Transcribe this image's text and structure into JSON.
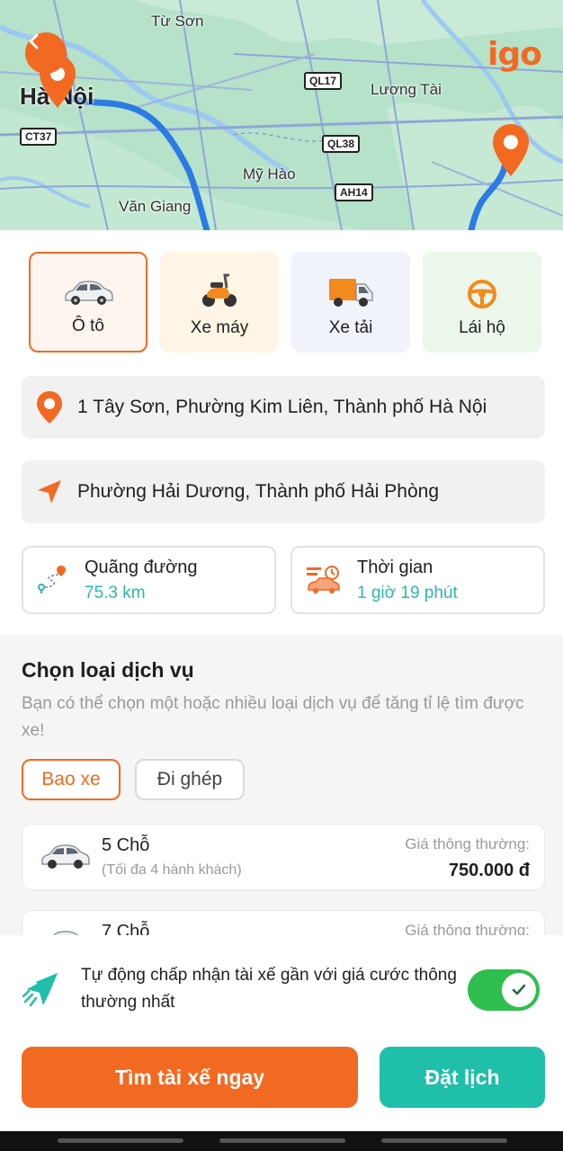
{
  "map": {
    "labels": {
      "tu_son": "Từ Sơn",
      "ha_noi": "Hà Nội",
      "luong_tai": "Lương Tài",
      "my_hao": "Mỹ Hào",
      "van_giang": "Văn Giang"
    },
    "road_badges": {
      "ql17": "QL17",
      "ct37": "CT37",
      "ql38": "QL38",
      "ah14": "AH14"
    },
    "logo": "igo"
  },
  "services": [
    {
      "label": "Ô tô",
      "icon": "car-icon",
      "selected": true
    },
    {
      "label": "Xe máy",
      "icon": "scooter-icon",
      "selected": false
    },
    {
      "label": "Xe tải",
      "icon": "truck-icon",
      "selected": false
    },
    {
      "label": "Lái hộ",
      "icon": "steering-wheel-icon",
      "selected": false
    }
  ],
  "route": {
    "pickup": "1 Tây Sơn, Phường Kim Liên, Thành phố Hà Nội",
    "destination": "Phường Hải Dương, Thành phố Hải Phòng"
  },
  "stats": {
    "distance_label": "Quãng đường",
    "distance_value": "75.3 km",
    "time_label": "Thời gian",
    "time_value": "1 giờ 19 phút"
  },
  "service_type": {
    "title": "Chọn loại dịch vụ",
    "description": "Bạn có thể chọn một hoặc nhiều loại dịch vụ để tăng tỉ lệ tìm được xe!",
    "options": [
      {
        "label": "Bao xe",
        "active": true
      },
      {
        "label": "Đi ghép",
        "active": false
      }
    ],
    "vehicles": [
      {
        "name": "5 Chỗ",
        "capacity": "(Tối đa 4 hành khách)",
        "price_label": "Giá thông thường:",
        "price": "750.000 đ"
      },
      {
        "name": "7 Chỗ",
        "capacity": "",
        "price_label": "Giá thông thường:",
        "price": ""
      }
    ]
  },
  "auto_accept": {
    "text": "Tự động chấp nhận tài xế gần với giá cước thông thường nhất",
    "enabled": true
  },
  "actions": {
    "find_now": "Tìm tài xế ngay",
    "schedule": "Đặt lịch"
  },
  "colors": {
    "brand_orange": "#f26a22",
    "teal": "#1fbfa9",
    "toggle_green": "#2fbf4f"
  }
}
